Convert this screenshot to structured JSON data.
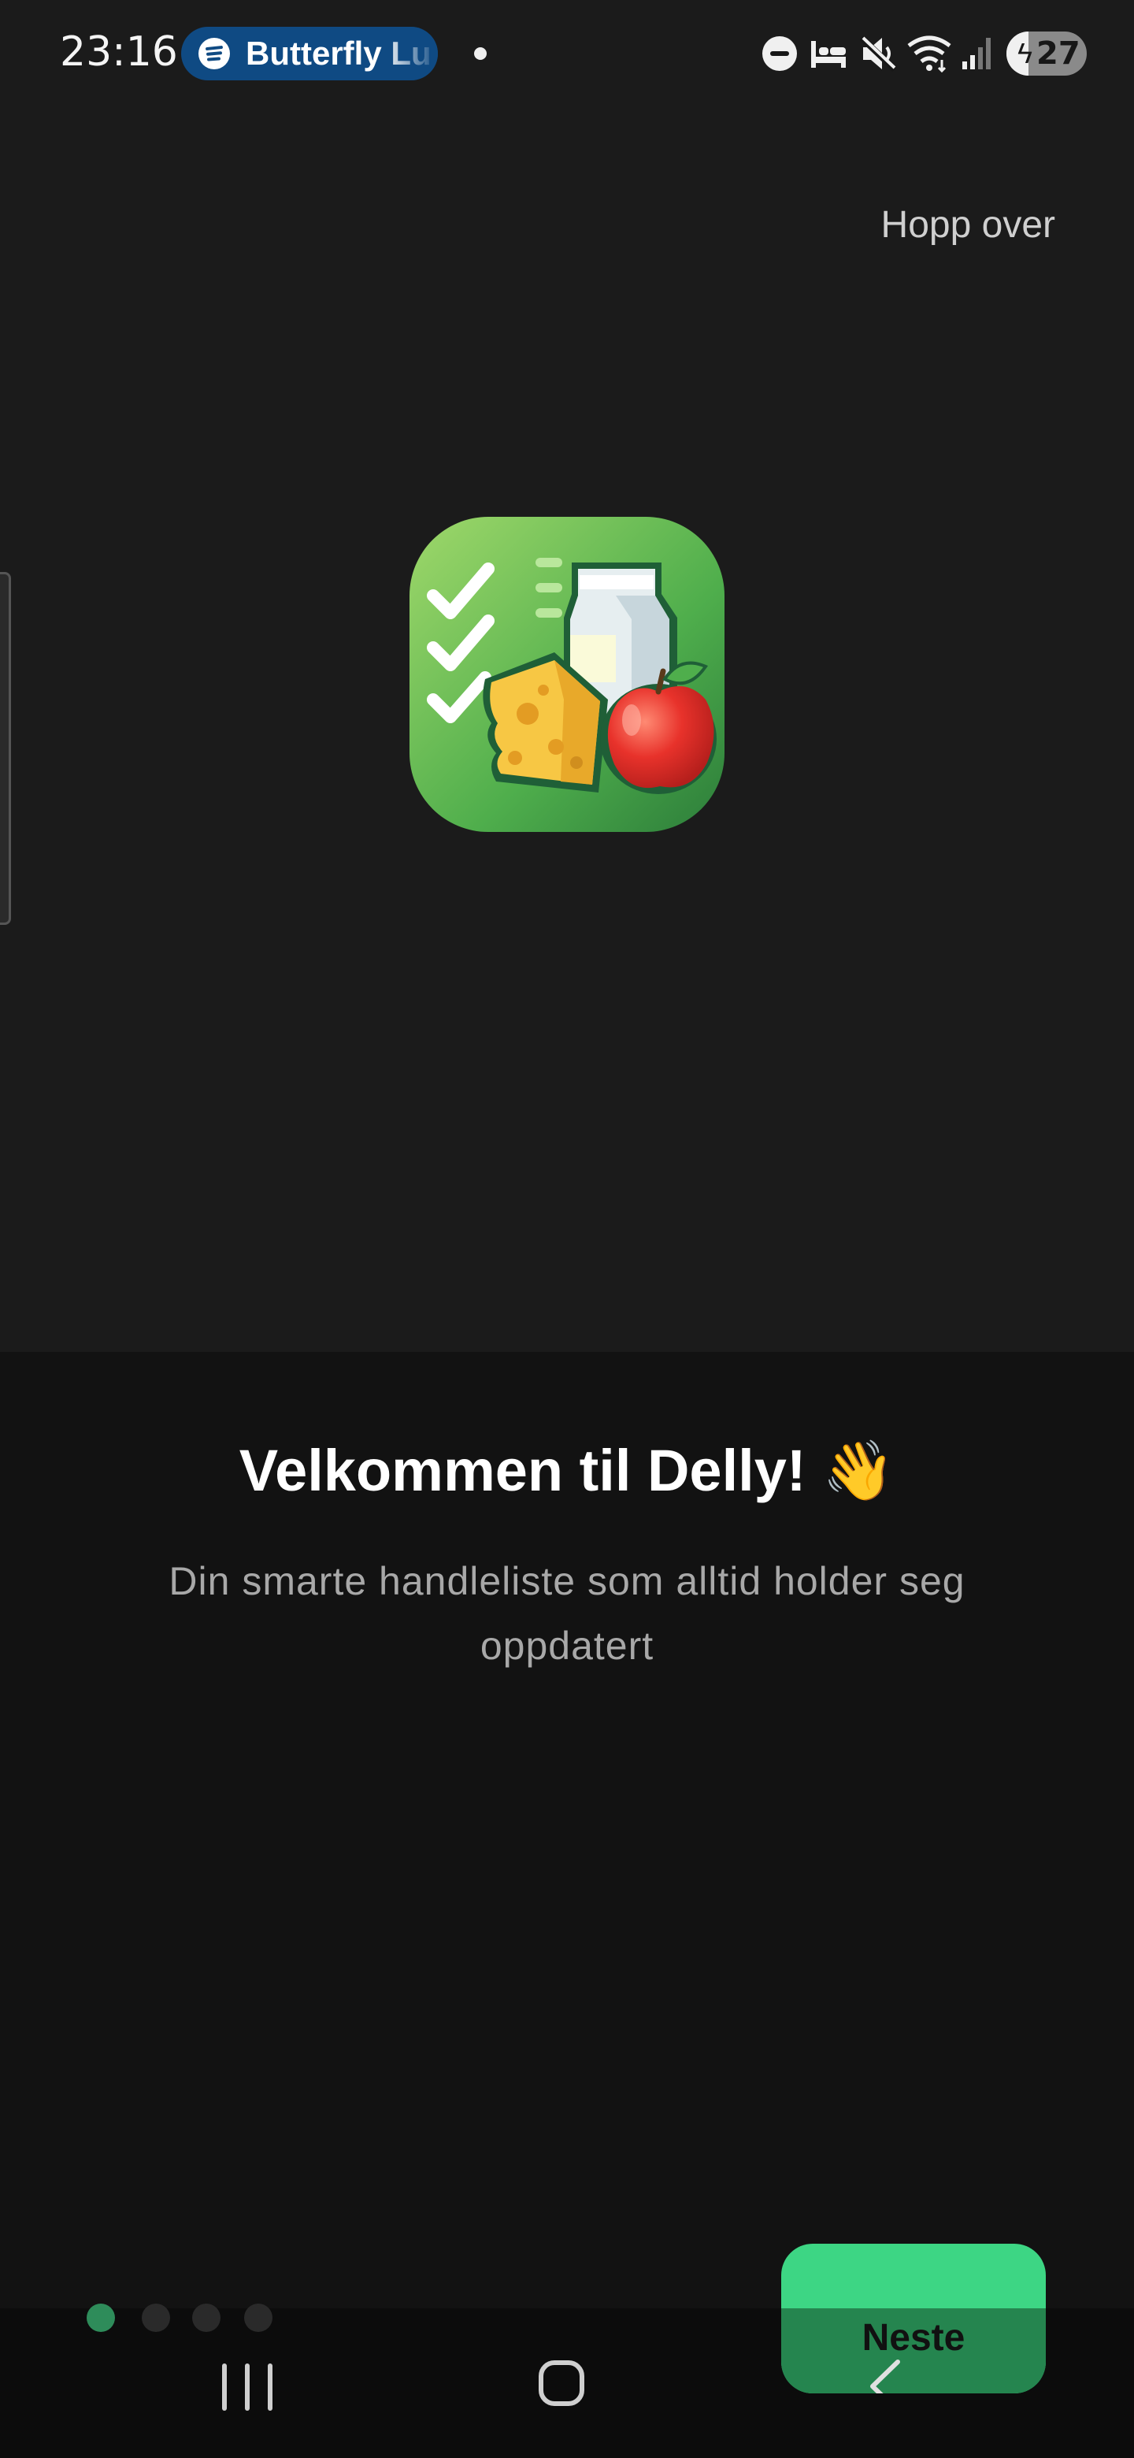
{
  "status_bar": {
    "time": "23:16",
    "media_track": "Butterfly Lu",
    "battery_level": "27",
    "icons": [
      "spotify-icon",
      "notification-dot",
      "do-not-disturb-icon",
      "sleep-mode-icon",
      "mute-icon",
      "wifi-icon",
      "signal-icon",
      "battery-charging-icon"
    ]
  },
  "header": {
    "skip_label": "Hopp over"
  },
  "hero": {
    "icon": "grocery-app-icon"
  },
  "welcome": {
    "title": "Velkommen til Delly! 👋",
    "subtitle": "Din smarte handleliste som alltid holder seg oppdatert"
  },
  "pagination": {
    "total": 4,
    "current": 1
  },
  "footer": {
    "next_label": "Neste"
  },
  "navigation": {
    "icons": [
      "recents-icon",
      "home-icon",
      "back-icon"
    ]
  },
  "colors": {
    "accent": "#3dd684",
    "accent_dark": "#25854f",
    "background": "#1b1b1b",
    "muted_text": "#a8a8a8"
  }
}
